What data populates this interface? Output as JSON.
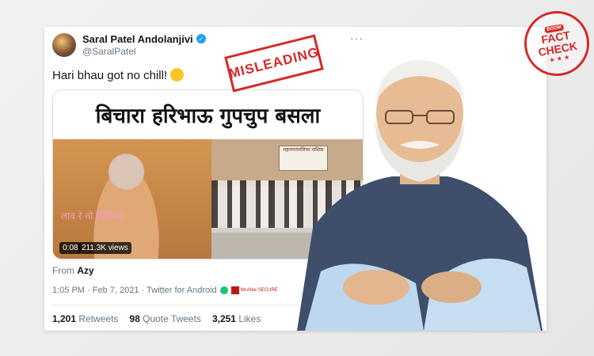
{
  "tweet": {
    "display_name": "Saral Patel Andolanjivi",
    "handle": "@SaralPatel",
    "text": "Hari bhau got no chill!",
    "media_caption": "बिचारा हरिभाऊ गुपचुप बसला",
    "video_time": "0:08",
    "video_views": "211.3K views",
    "from_label": "From",
    "from_account": "Azy",
    "timestamp": "1:05 PM · Feb 7, 2021 · Twitter for Android",
    "retweets_count": "1,201",
    "retweets_label": "Retweets",
    "quote_count": "98",
    "quote_label": "Quote Tweets",
    "likes_count": "3,251",
    "likes_label": "Likes",
    "video_watermark": "लाव रे तो व्हिडिओ",
    "video_sign": "महानगरपालिका नाशिक",
    "mcafee": "McAfee SECURE"
  },
  "overlays": {
    "stamp_text": "MISLEADING",
    "badge_top": "BOOM",
    "badge_line1": "FACT",
    "badge_line2": "CHECK",
    "badge_stars": "★ ★ ★"
  },
  "icons": [
    "verified-icon",
    "more-icon",
    "laughing-emoji-icon",
    "security-icon"
  ],
  "colors": {
    "stamp": "#d62828",
    "verified": "#1da1f2",
    "muted": "#657786"
  }
}
